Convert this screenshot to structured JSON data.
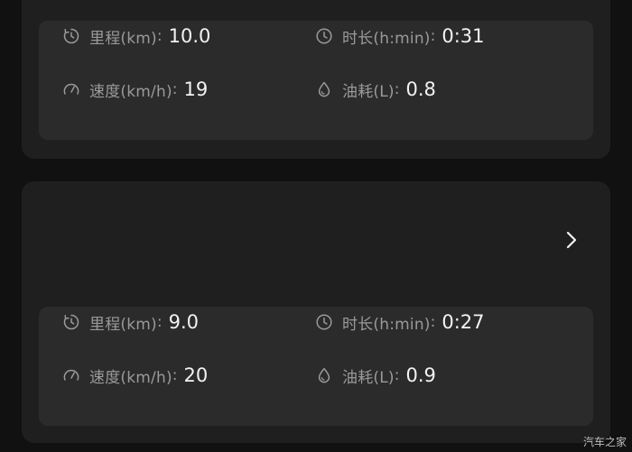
{
  "theme": {
    "background": "#111111",
    "card": "#1f1f1f",
    "panel": "#2b2b2b",
    "label_color": "#9a9a9a",
    "value_color": "#f2f2f2"
  },
  "labels": {
    "distance": "里程(km)",
    "duration": "时长(h:min)",
    "speed": "速度(km/h)",
    "fuel": "油耗(L)",
    "colon": ":"
  },
  "icons": {
    "distance": "timer-cycle-icon",
    "duration": "clock-icon",
    "speed": "speedometer-icon",
    "fuel": "droplet-icon",
    "chevron": "chevron-right-icon"
  },
  "trips": [
    {
      "distance": "10.0",
      "duration": "0:31",
      "speed": "19",
      "fuel": "0.8"
    },
    {
      "distance": "9.0",
      "duration": "0:27",
      "speed": "20",
      "fuel": "0.9"
    }
  ],
  "watermark": "汽车之家"
}
